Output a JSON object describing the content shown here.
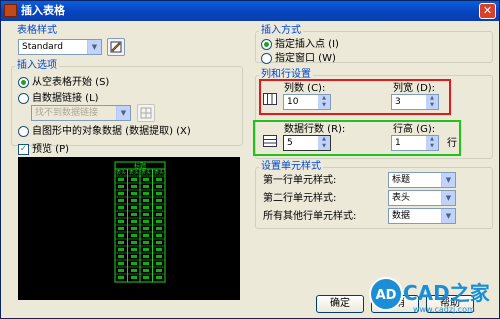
{
  "window": {
    "title": "插入表格",
    "close_glyph": "✕"
  },
  "table_style": {
    "label": "表格样式",
    "value": "Standard"
  },
  "insert_options": {
    "label": "插入选项",
    "opt1": "从空表格开始 (S)",
    "opt2": "自数据链接 (L)",
    "link_placeholder": "找不到数据链接",
    "opt3": "自图形中的对象数据 (数据提取) (X)"
  },
  "preview": {
    "label": "预览 (P)",
    "checked": "✓",
    "header_text": "标题",
    "cell_text": "表头",
    "data_text": "数据"
  },
  "insert_method": {
    "label": "插入方式",
    "opt1": "指定插入点 (I)",
    "opt2": "指定窗口 (W)"
  },
  "col_row": {
    "label": "列和行设置",
    "columns_label": "列数 (C):",
    "columns_value": "10",
    "colwidth_label": "列宽 (D):",
    "colwidth_value": "3",
    "rows_label": "数据行数 (R):",
    "rows_value": "5",
    "rowheight_label": "行高 (G):",
    "rowheight_value": "1",
    "rowheight_unit": "行"
  },
  "cell_styles": {
    "label": "设置单元样式",
    "first_row_label": "第一行单元样式:",
    "first_row_value": "标题",
    "second_row_label": "第二行单元样式:",
    "second_row_value": "表头",
    "other_rows_label": "所有其他行单元样式:",
    "other_rows_value": "数据"
  },
  "buttons": {
    "ok": "确定",
    "cancel": "取消",
    "help": "帮助"
  },
  "watermark": {
    "text": "CAD之家",
    "url": "www.cadzj.com",
    "badge": "AD"
  }
}
